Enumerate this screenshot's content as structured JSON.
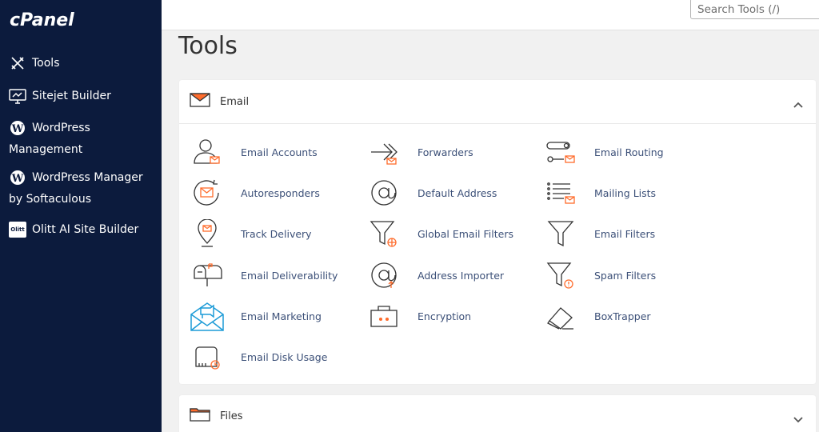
{
  "brand": {
    "logo_text": "cPanel"
  },
  "sidebar": {
    "items": [
      {
        "label": "Tools"
      },
      {
        "label": "Sitejet Builder"
      },
      {
        "label": "WordPress",
        "label2": "Management"
      },
      {
        "label": "WordPress Manager",
        "label2": "by Softaculous"
      },
      {
        "label": "Olitt AI Site Builder",
        "badge": "Olitt"
      }
    ]
  },
  "topbar": {
    "search_placeholder": "Search Tools (/)"
  },
  "page": {
    "title": "Tools"
  },
  "sections": {
    "email": {
      "label": "Email",
      "tools": [
        "Email Accounts",
        "Forwarders",
        "Email Routing",
        "Autoresponders",
        "Default Address",
        "Mailing Lists",
        "Track Delivery",
        "Global Email Filters",
        "Email Filters",
        "Email Deliverability",
        "Address Importer",
        "Spam Filters",
        "Email Marketing",
        "Encryption",
        "BoxTrapper",
        "Email Disk Usage"
      ]
    },
    "files": {
      "label": "Files"
    }
  },
  "colors": {
    "sidebar_bg": "#0c1b3d",
    "accent": "#ff6c2c",
    "link": "#3c5078"
  }
}
